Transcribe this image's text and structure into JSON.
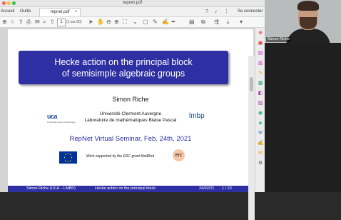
{
  "window": {
    "title": "repnet.pdf"
  },
  "tabs": {
    "accueil": "Accueil",
    "outils": "Outils",
    "document": "repnet.pdf",
    "close": "×"
  },
  "toolbar": {
    "page_current": "1",
    "page_count": "(1 sur 60)",
    "connect_label": "Se connecter"
  },
  "slide": {
    "title_line1": "Hecke action on the principal block",
    "title_line2": "of semisimple algebraic groups",
    "author": "Simon Riche",
    "affiliation_line1": "Université Clermont Auvergne",
    "affiliation_line2": "Laboratoire de mathématiques Blaise Pascal",
    "seminar": "RepNet Virtual Seminar, Feb. 24th, 2021",
    "support": "Work supported by the ERC grant ModRed",
    "uca_logo": "uca",
    "uca_logo_sub": "Université Clermont Auvergne",
    "lmbp_logo": "lmbp",
    "erc_logo": "erc",
    "footer": {
      "left": "Simon Riche (UCA – LMBP)",
      "center": "Hecke action on the principal block",
      "date": "24/02/21",
      "page": "1 / 23"
    }
  },
  "video": {
    "participant_name": "Simon Riche"
  },
  "colors": {
    "accent": "#2f2fa4",
    "traffic_red": "#ff5f57",
    "traffic_yellow": "#febc2e",
    "traffic_green": "#28c840"
  }
}
